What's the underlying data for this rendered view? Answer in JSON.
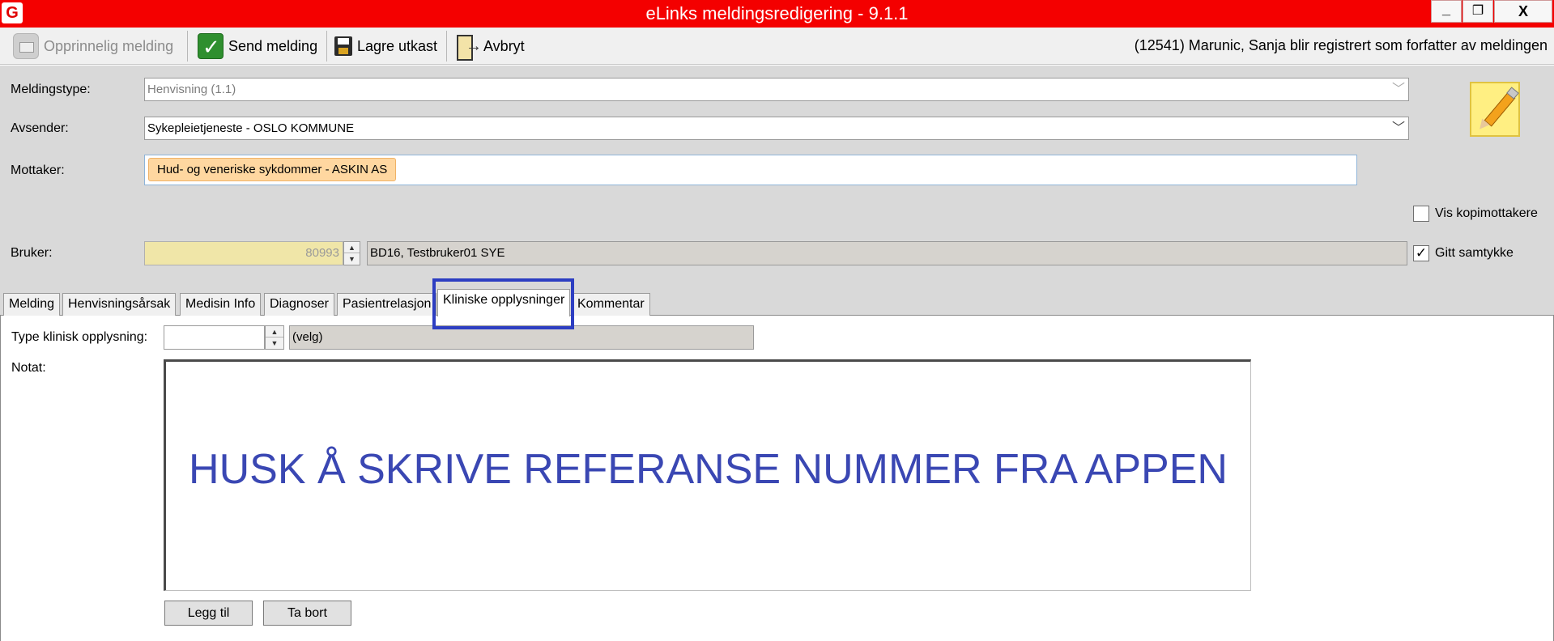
{
  "window": {
    "title": "eLinks meldingsredigering - 9.1.1",
    "app_icon": "G",
    "icons": [
      "app-icon",
      "minimize-icon",
      "restore-icon",
      "close-icon"
    ]
  },
  "toolbar": {
    "original_label": "Opprinnelig melding",
    "send_label": "Send melding",
    "save_draft_label": "Lagre utkast",
    "cancel_label": "Avbryt",
    "author_info": "(12541) Marunic, Sanja blir registrert som forfatter av meldingen",
    "icons": [
      "envelope-icon",
      "check-icon",
      "floppy-disk-icon",
      "exit-door-icon"
    ]
  },
  "form": {
    "message_type_label": "Meldingstype:",
    "message_type_value": "Henvisning (1.1)",
    "sender_label": "Avsender:",
    "sender_value": "Sykepleietjeneste - OSLO KOMMUNE",
    "recipient_label": "Mottaker:",
    "recipient_tag": "Hud- og veneriske sykdommer - ASKIN AS",
    "show_copy_recipients_label": "Vis kopimottakere",
    "show_copy_recipients_checked": false,
    "user_label": "Bruker:",
    "user_id": "80993",
    "user_name": "BD16, Testbruker01 SYE",
    "consent_label": "Gitt samtykke",
    "consent_checked": true,
    "consent_check_mark": "✓",
    "edit_icon": "pencil-icon"
  },
  "tabs": [
    {
      "label": "Melding",
      "active": false
    },
    {
      "label": "Henvisningsårsak",
      "active": false
    },
    {
      "label": "Medisin Info",
      "active": false
    },
    {
      "label": "Diagnoser",
      "active": false
    },
    {
      "label": "Pasientrelasjon",
      "active": false
    },
    {
      "label": "Kliniske opplysninger",
      "active": true
    },
    {
      "label": "Kommentar",
      "active": false
    }
  ],
  "clinical": {
    "type_label": "Type klinisk opplysning:",
    "type_value": "",
    "select_value": "(velg)",
    "note_label": "Notat:",
    "note_text": "HUSK Å SKRIVE REFERANSE NUMMER FRA APPEN",
    "add_label": "Legg til",
    "remove_label": "Ta bort"
  },
  "colors": {
    "titlebar": "#f40000",
    "highlight": "#2d3ec2",
    "note_text": "#3a47b3",
    "recipient_tag": "#ffd7a0",
    "user_id_field": "#f0e6a8"
  }
}
